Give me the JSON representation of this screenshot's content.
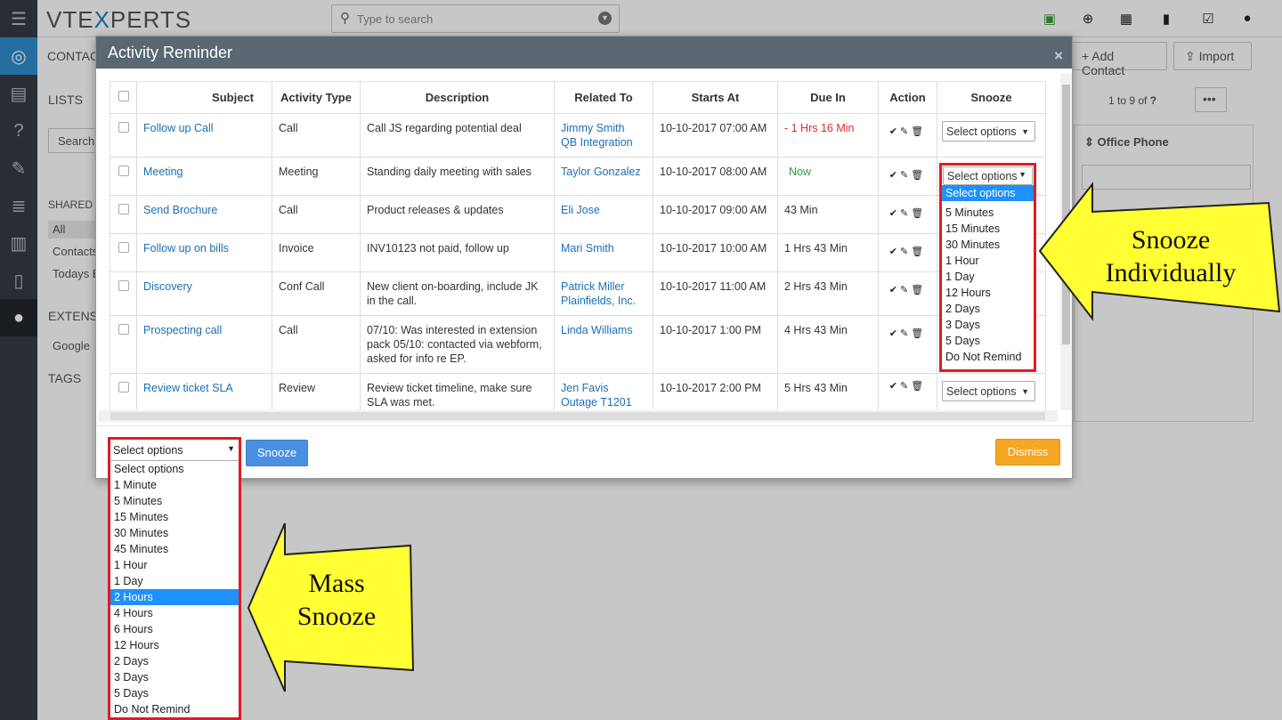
{
  "app": {
    "logo_prefix": "VTE",
    "logo_x": "X",
    "logo_suffix": "PERTS"
  },
  "search": {
    "placeholder": "Type to search"
  },
  "top_icons": [
    "calendar-check-icon",
    "plus-circle-icon",
    "calendar-icon",
    "bar-chart-icon",
    "checkbox-icon",
    "user-icon"
  ],
  "background": {
    "module": "CONTACT",
    "lists_heading": "LISTS",
    "search_label": "Search",
    "shared_label": "SHARED L",
    "shared_items": [
      "All",
      "Contacts",
      "Todays B"
    ],
    "extensions_label": "EXTENSI",
    "google_label": "Google",
    "tags_label": "TAGS",
    "add_contact": "Add Contact",
    "import": "Import",
    "pagination": "1 to 9",
    "pagination_of": "of",
    "pagination_total": "?",
    "office_phone": "Office Phone"
  },
  "modal": {
    "title": "Activity Reminder",
    "close": "×",
    "columns": [
      "Subject",
      "Activity Type",
      "Description",
      "Related To",
      "Starts At",
      "Due In",
      "Action",
      "Snooze"
    ],
    "rows": [
      {
        "subject": "Follow up Call",
        "type": "Call",
        "description": "Call JS regarding potential deal",
        "related": "Jimmy Smith",
        "related2": "QB Integration",
        "starts": "10-10-2017 07:00 AM",
        "due": "- 1 Hrs 16 Min",
        "due_status": "overdue",
        "snooze": "Select options"
      },
      {
        "subject": "Meeting",
        "type": "Meeting",
        "description": "Standing daily meeting with sales",
        "related": "Taylor Gonzalez",
        "related2": "",
        "starts": "10-10-2017 08:00 AM",
        "due": "Now",
        "due_status": "now",
        "snooze": "Select options"
      },
      {
        "subject": "Send Brochure",
        "type": "Call",
        "description": "Product releases & updates",
        "related": "Eli Jose",
        "related2": "",
        "starts": "10-10-2017 09:00 AM",
        "due": "43 Min",
        "due_status": "",
        "snooze": ""
      },
      {
        "subject": "Follow up on bills",
        "type": "Invoice",
        "description": "INV10123 not paid, follow up",
        "related": "Mari Smith",
        "related2": "",
        "starts": "10-10-2017 10:00 AM",
        "due": "1 Hrs 43 Min",
        "due_status": "",
        "snooze": ""
      },
      {
        "subject": "Discovery",
        "type": "Conf Call",
        "description": "New client on-boarding, include JK in the call.",
        "related": "Patrick Miller",
        "related2": "Plainfields, Inc.",
        "starts": "10-10-2017 11:00 AM",
        "due": "2 Hrs 43 Min",
        "due_status": "",
        "snooze": ""
      },
      {
        "subject": "Prospecting call",
        "type": "Call",
        "description": "07/10: Was interested in extension pack 05/10: contacted via webform, asked for info re EP.",
        "related": "Linda Williams",
        "related2": "",
        "starts": "10-10-2017 1:00 PM",
        "due": "4 Hrs 43 Min",
        "due_status": "",
        "snooze": ""
      },
      {
        "subject": "Review ticket SLA",
        "type": "Review",
        "description": "Review ticket timeline, make sure SLA was met.",
        "related": "Jen Favis",
        "related2": "Outage T1201",
        "starts": "10-10-2017 2:00 PM",
        "due": "5 Hrs 43 Min",
        "due_status": "",
        "snooze": "Select options"
      }
    ],
    "individual_options": [
      "Select options",
      "5 Minutes",
      "15 Minutes",
      "30 Minutes",
      "1 Hour",
      "1 Day",
      "12 Hours",
      "2 Days",
      "3 Days",
      "5 Days",
      "Do Not Remind"
    ],
    "mass_select": "Select options",
    "mass_options": [
      "Select options",
      "1 Minute",
      "5 Minutes",
      "15 Minutes",
      "30 Minutes",
      "45 Minutes",
      "1 Hour",
      "1 Day",
      "2 Hours",
      "4 Hours",
      "6 Hours",
      "12 Hours",
      "2 Days",
      "3 Days",
      "5 Days",
      "Do Not Remind"
    ],
    "mass_selected_index": 8,
    "snooze_button": "Snooze",
    "dismiss_button": "Dismiss"
  },
  "callouts": {
    "individual_line1": "Snooze",
    "individual_line2": "Individually",
    "mass_line1": "Mass",
    "mass_line2": "Snooze"
  },
  "colors": {
    "accent": "#4a90e2",
    "dismiss": "#f5a623",
    "highlight": "#1e90ff",
    "callout": "#ffff33",
    "overdue": "#e02b2b",
    "now": "#2e9e3b"
  }
}
